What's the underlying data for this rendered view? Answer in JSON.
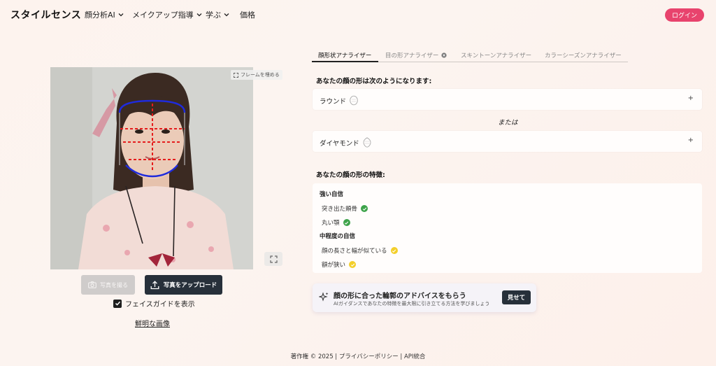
{
  "nav": {
    "brand": "スタイルセンス",
    "items": [
      {
        "label": "顔分析AI",
        "has_dropdown": true
      },
      {
        "label": "メイクアップ指導",
        "has_dropdown": true
      },
      {
        "label": "学ぶ",
        "has_dropdown": true
      },
      {
        "label": "価格",
        "has_dropdown": false
      }
    ],
    "login": "ログイン"
  },
  "camera": {
    "fill_frame": "フレームを埋める",
    "take_photo": "写真を撮る",
    "upload": "写真をアップロード",
    "show_guide": "フェイスガイドを表示",
    "show_guide_checked": true,
    "clear_image": "鮮明な画像"
  },
  "tabs": [
    {
      "label": "顔形状アナライザー",
      "active": true
    },
    {
      "label": "目の形アナライザー",
      "active": false
    },
    {
      "label": "スキントーンアナライザー",
      "active": false
    },
    {
      "label": "カラーシーズンアナライザー",
      "active": false
    }
  ],
  "result": {
    "heading": "あなたの顔の形は次のようになります:",
    "shapes": [
      {
        "name": "ラウンド",
        "toggle": "+"
      },
      {
        "name": "ダイヤモンド",
        "toggle": "+"
      }
    ],
    "or_text": "または"
  },
  "features": {
    "heading": "あなたの顔の形の特徴:",
    "groups": [
      {
        "title": "強い自信",
        "items": [
          "突き出た頬骨",
          "丸い顎"
        ],
        "status": "green"
      },
      {
        "title": "中程度の自信",
        "items": [
          "顔の長さと幅が似ている",
          "額が狭い"
        ],
        "status": "yellow"
      }
    ]
  },
  "advice": {
    "title": "顔の形に合った輪郭のアドバイスをもらう",
    "subtitle": "AIガイダンスであなたの特徴を最大限に引き立てる方法を学びましょう",
    "button": "見せて"
  },
  "footer": {
    "text": "著作権 © 2025 | プライバシーポリシー | API統合"
  },
  "colors": {
    "accent": "#e8436d",
    "dark_button": "#27303a",
    "strong": "#3da34a",
    "medium": "#f3cf2b"
  }
}
